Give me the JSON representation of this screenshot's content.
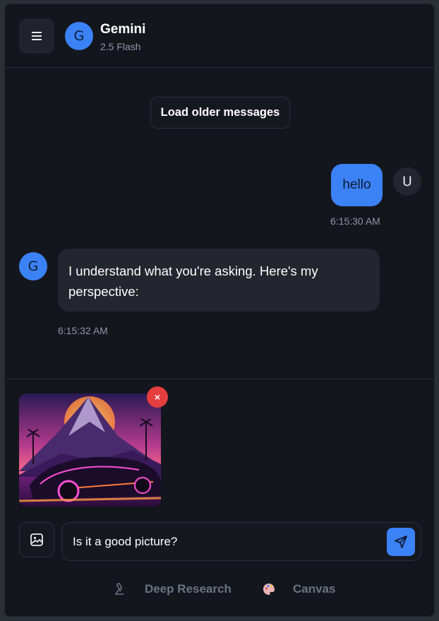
{
  "header": {
    "avatar_letter": "G",
    "title": "Gemini",
    "subtitle": "2.5 Flash",
    "menu_icon": "menu-icon"
  },
  "messages": {
    "load_older_label": "Load older messages",
    "items": [
      {
        "role": "user",
        "avatar_letter": "U",
        "text": "hello",
        "timestamp": "6:15:30 AM"
      },
      {
        "role": "assistant",
        "avatar_letter": "G",
        "text": "I understand what you're asking. Here's my perspective:",
        "timestamp": "6:15:32 AM"
      }
    ]
  },
  "composer": {
    "attachment": {
      "remove_label": "×"
    },
    "input_value": "Is it a good picture?",
    "image_button_icon": "image-icon",
    "send_icon": "send-icon",
    "tools": [
      {
        "label": "Deep Research",
        "icon": "microscope-icon"
      },
      {
        "label": "Canvas",
        "icon": "palette-icon"
      }
    ]
  },
  "colors": {
    "accent": "#3b82f6",
    "background": "#14161d",
    "bubble_assistant": "#23262e",
    "remove": "#e53e3e",
    "muted_text": "#8e95a3"
  }
}
